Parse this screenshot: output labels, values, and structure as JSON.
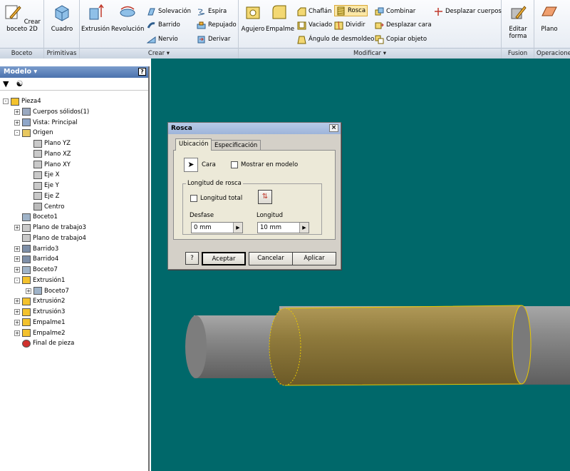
{
  "ribbon": {
    "groups": {
      "boceto": "Boceto",
      "primitivas": "Primitivas",
      "crear": "Crear ▾",
      "modificar": "Modificar ▾",
      "fusion": "Fusion",
      "operaciones": "Operaciones"
    },
    "crear_boceto": "Crear boceto 2D",
    "cuadro": "Cuadro",
    "extrusion": "Extrusión",
    "revolucion": "Revolución",
    "solevacion": "Solevación",
    "barrido": "Barrido",
    "nervio": "Nervio",
    "espira": "Espira",
    "repujado": "Repujado",
    "derivar": "Derivar",
    "agujero": "Agujero",
    "empalme": "Empalme",
    "chaflan": "Chaflán",
    "vaciado": "Vaciado",
    "angulo": "Ángulo de desmoldeo",
    "rosca": "Rosca",
    "dividir": "Dividir",
    "combinar": "Combinar",
    "desplazar_cara": "Desplazar cara",
    "copiar_objeto": "Copiar objeto",
    "desplazar_cuerpos": "Desplazar cuerpos",
    "editar_forma": "Editar forma",
    "plano": "Plano"
  },
  "browser": {
    "title": "Modelo ▾",
    "help": "?",
    "nodes": [
      "Pieza4",
      "Cuerpos sólidos(1)",
      "Vista: Principal",
      "Origen",
      "Plano YZ",
      "Plano XZ",
      "Plano XY",
      "Eje X",
      "Eje Y",
      "Eje Z",
      "Centro",
      "Boceto1",
      "Plano de trabajo3",
      "Plano de trabajo4",
      "Barrido3",
      "Barrido4",
      "Boceto7",
      "Extrusión1",
      "Boceto7",
      "Extrusión2",
      "Extrusión3",
      "Empalme1",
      "Empalme2",
      "Final de pieza"
    ]
  },
  "dialog": {
    "title": "Rosca",
    "close": "×",
    "tab1": "Ubicación",
    "tab2": "Especificación",
    "cara": "Cara",
    "mostrar": "Mostrar en modelo",
    "longitud_group": "Longitud de rosca",
    "longitud_total": "Longitud total",
    "desfase_label": "Desfase",
    "desfase_value": "0 mm",
    "longitud_label": "Longitud",
    "longitud_value": "10 mm",
    "help": "?",
    "aceptar": "Aceptar",
    "cancelar": "Cancelar",
    "aplicar": "Aplicar"
  }
}
